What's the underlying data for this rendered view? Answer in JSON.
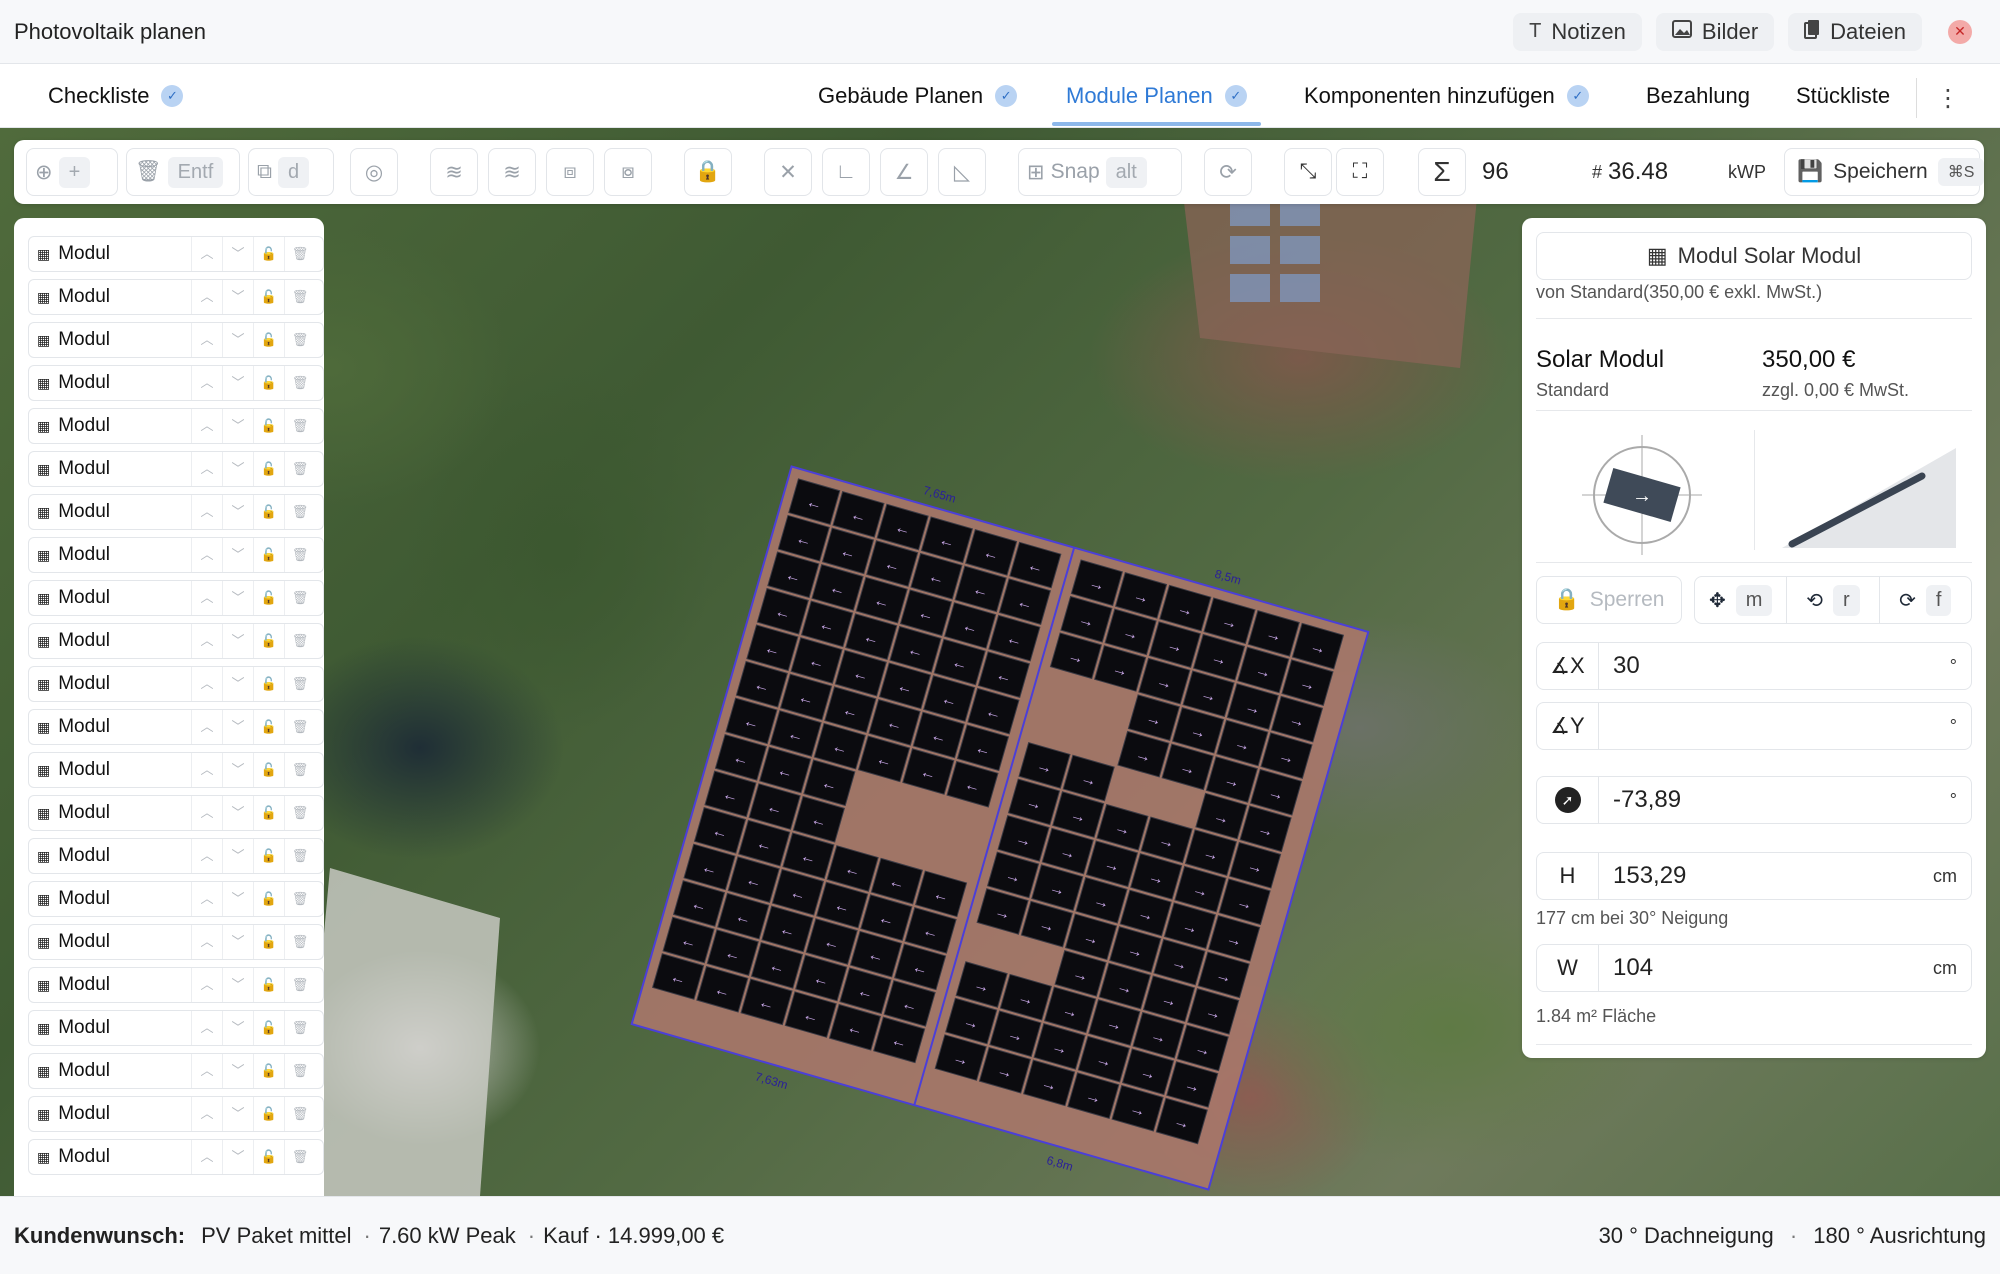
{
  "window": {
    "title": "Photovoltaik planen",
    "buttons": {
      "notes": "Notizen",
      "images": "Bilder",
      "files": "Dateien"
    }
  },
  "tabs": [
    {
      "label": "Checkliste",
      "done": true
    },
    {
      "label": "Gebäude Planen",
      "done": true
    },
    {
      "label": "Module Planen",
      "done": true,
      "active": true
    },
    {
      "label": "Komponenten hinzufügen",
      "done": true
    },
    {
      "label": "Bezahlung",
      "done": false
    },
    {
      "label": "Stückliste",
      "done": false
    }
  ],
  "toolbar": {
    "add_label": "+",
    "delete_label": "Entf",
    "duplicate_key": "d",
    "snap_label": "Snap",
    "snap_key": "alt",
    "module_count": "96",
    "count_unit": "#",
    "kwp_value": "36.48",
    "kwp_unit": "kWP",
    "save_label": "Speichern",
    "save_key": "⌘S"
  },
  "module_list": {
    "item_label": "Modul",
    "count": 22
  },
  "properties": {
    "module_button": "Modul Solar Modul",
    "source": "von Standard(350,00 € exkl. MwSt.)",
    "name": "Solar Modul",
    "category": "Standard",
    "price": "350,00 €",
    "tax": "zzgl. 0,00 € MwSt.",
    "lock_label": "Sperren",
    "move_key": "m",
    "rotate_key": "r",
    "flip_key": "f",
    "x_label": "X",
    "x_value": "30",
    "y_label": "Y",
    "y_value": "",
    "angle_value": "-73,89",
    "height_label": "H",
    "height_value": "153,29",
    "height_note": "177 cm bei 30° Neigung",
    "width_label": "W",
    "width_value": "104",
    "unit_cm": "cm",
    "unit_deg": "°",
    "area_value": "1.84",
    "area_unit": "m²",
    "area_label": "Fläche"
  },
  "footer": {
    "label": "Kundenwunsch:",
    "package": "PV Paket mittel",
    "peak": "7.60 kW Peak",
    "purchase": "Kauf · 14.999,00 €",
    "pitch": "30 ° Dachneigung",
    "orientation": "180 ° Ausrichtung"
  },
  "colors": {
    "accent": "#2f7ad6",
    "panel_black": "#0b0b0f",
    "arrow": "#c7a6e6",
    "outline": "#4b3fd8",
    "roof": "#b07a6a"
  }
}
